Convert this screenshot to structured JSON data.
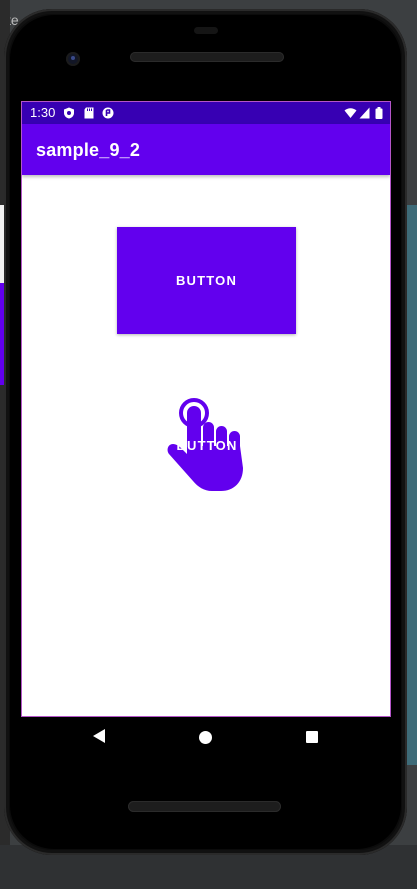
{
  "background": {
    "tab_text": "te"
  },
  "status_bar": {
    "time": "1:30",
    "icons": [
      "shield-icon",
      "sd-card-icon",
      "app-notification-icon"
    ],
    "right_icons": [
      "wifi-icon",
      "signal-icon",
      "battery-icon"
    ]
  },
  "app_bar": {
    "title": "sample_9_2"
  },
  "buttons": [
    {
      "label": "BUTTON"
    },
    {
      "label": "BUTTON"
    }
  ],
  "nav_bar": {
    "items": [
      "back-icon",
      "home-icon",
      "recents-icon"
    ]
  },
  "colors": {
    "primary": "#6200ee",
    "primary_dark": "#3700b3",
    "on_primary": "#ffffff",
    "screen_background": "#ffffff"
  }
}
